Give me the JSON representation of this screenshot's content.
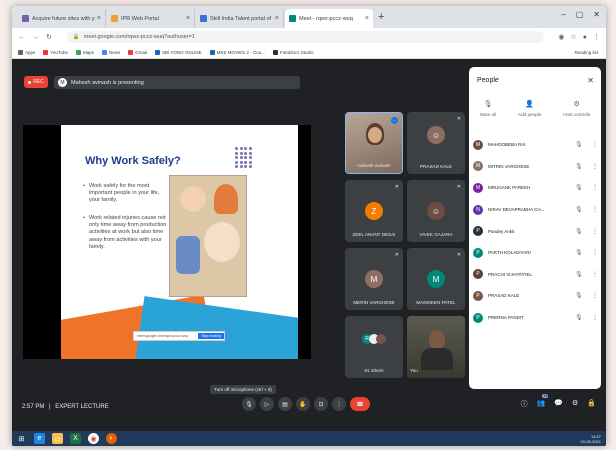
{
  "browser": {
    "tabs": [
      {
        "title": "Acquire future sites with your...",
        "color": "#7b5ea7",
        "active": false
      },
      {
        "title": "IPR Web Portal",
        "color": "#e8a33d",
        "active": false
      },
      {
        "title": "Skill India Talent portal of ...",
        "color": "#3b6fd1",
        "active": false
      },
      {
        "title": "Meet - rqwz-pccz-wuq",
        "color": "#00897b",
        "active": true
      }
    ],
    "address": "meet.google.com/rqwz-pccz-wuq?authuser=1",
    "bookmarks": [
      {
        "label": "Apps",
        "color": "#5f6368"
      },
      {
        "label": "YouTube",
        "color": "#e53935"
      },
      {
        "label": "Maps",
        "color": "#34a853"
      },
      {
        "label": "News",
        "color": "#4285f4"
      },
      {
        "label": "Gmail",
        "color": "#ea4335"
      },
      {
        "label": "SBI YONO ONLINE",
        "color": "#1565c0"
      },
      {
        "label": "MSE MOVIES 2 - Cou...",
        "color": "#1565c0"
      },
      {
        "label": "Fotoblocs Studio",
        "color": "#263238"
      }
    ],
    "reading_list": "Reading list"
  },
  "meet": {
    "rec_label": "REC",
    "presenting_text": "Mahesh avinash is presenting",
    "presenter_initial": "M",
    "slide": {
      "title": "Why Work Safely?",
      "bullet1": "Work safely for the most important people in your life, your family.",
      "bullet2": "Work related injuries cause not only time away from production activities at work but also time away from activities with your family.",
      "url_hint": "meet.google.com/rqwz-pccz-wuq",
      "url_button": "Stop sharing"
    },
    "tiles": [
      {
        "name": "mahesh avinash",
        "type": "video"
      },
      {
        "name": "PRASAD KALE",
        "type": "photo"
      },
      {
        "name": "ZEEL ANANT DESAI",
        "initial": "Z",
        "color": "#f57c00"
      },
      {
        "name": "VIVEK GAJARA",
        "type": "photo"
      },
      {
        "name": "MERIN VARGHESE",
        "initial": "M",
        "color": "#8d6e63"
      },
      {
        "name": "MANSIKEN PATEL",
        "initial": "M",
        "color": "#00897b"
      },
      {
        "name": "91 others",
        "type": "others"
      },
      {
        "name": "You",
        "type": "video"
      }
    ],
    "time": "2:57 PM",
    "separator": "|",
    "meeting_name": "EXPERT LECTURE",
    "tooltip": "Turn off microphone (ctrl + d)",
    "controls": [
      "mic-icon",
      "camera-icon",
      "captions-icon",
      "raise-hand-icon",
      "present-icon",
      "more-icon",
      "end-call-icon"
    ],
    "right_controls": [
      "info-icon",
      "people-icon",
      "chat-icon",
      "activities-icon",
      "lock-icon"
    ],
    "people_count": "99"
  },
  "people": {
    "title": "People",
    "actions": [
      {
        "label": "Mute all",
        "icon": "mic-off-icon"
      },
      {
        "label": "Add people",
        "icon": "add-person-icon"
      },
      {
        "label": "Host controls",
        "icon": "host-controls-icon"
      }
    ],
    "list": [
      {
        "name": "MAHOOBEBA RAI",
        "initial": "M",
        "color": "#6d4c41"
      },
      {
        "name": "MITRIN VARGHESE",
        "initial": "M",
        "color": "#8d6e63"
      },
      {
        "name": "MRUGANK PAREKH",
        "initial": "M",
        "color": "#7b1fa2"
      },
      {
        "name": "NIRAV DEVAPRABHA CH...",
        "initial": "N",
        "color": "#5e35b1"
      },
      {
        "name": "Pandey Ankit",
        "initial": "P",
        "color": "#263238"
      },
      {
        "name": "PARTH KOLADIYARI",
        "initial": "P",
        "color": "#00897b"
      },
      {
        "name": "PRACHI VIJAYPATEL",
        "initial": "P",
        "color": "#5d4037"
      },
      {
        "name": "PRASAD KALE",
        "initial": "P",
        "color": "#795548"
      },
      {
        "name": "PRERNA PANDIT",
        "initial": "P",
        "color": "#00897b"
      }
    ]
  },
  "taskbar": {
    "apps": [
      "start-icon",
      "edge-icon",
      "file-explorer-icon",
      "excel-icon",
      "chrome-icon",
      "firefox-icon"
    ],
    "clock_time": "14:57",
    "clock_date": "09-06-2021"
  }
}
